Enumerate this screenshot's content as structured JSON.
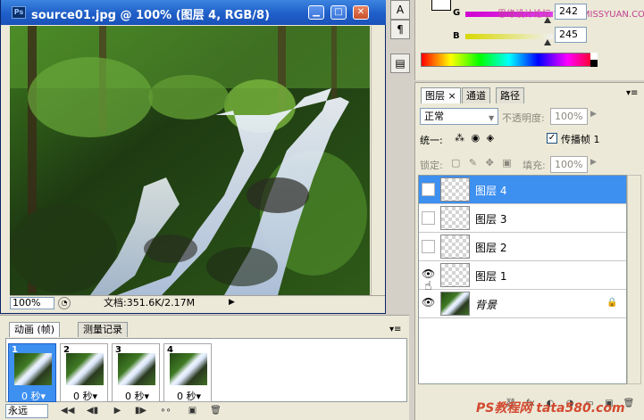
{
  "document": {
    "title": "source01.jpg @ 100% (图层 4, RGB/8)",
    "app_icon": "Ps",
    "window_buttons": {
      "minimize": "▁",
      "maximize": "□",
      "close": "✕"
    },
    "zoom": "100%",
    "doc_info": "文档:351.6K/2.17M",
    "status_arrow": "▶"
  },
  "side_strip": {
    "icons": [
      "A",
      "¶",
      "▤"
    ]
  },
  "color_panel": {
    "g_label": "G",
    "b_label": "B",
    "g_value": "242",
    "b_value": "245",
    "watermark": "思缘设计论坛 WWW.MISSYUAN.COM",
    "colors": {
      "g_track": "#e040f0",
      "b_track": "#e8e800"
    }
  },
  "animation_panel": {
    "tabs": [
      {
        "label": "动画 (帧)"
      },
      {
        "label": "测量记录"
      }
    ],
    "menu_icon": "▾≡",
    "frames": [
      {
        "number": "1",
        "delay": "0 秒▾",
        "selected": true
      },
      {
        "number": "2",
        "delay": "0 秒▾",
        "selected": false
      },
      {
        "number": "3",
        "delay": "0 秒▾",
        "selected": false
      },
      {
        "number": "4",
        "delay": "0 秒▾",
        "selected": false
      }
    ],
    "loop": "永远",
    "toolbar_icons": [
      "◀◀",
      "◀▮",
      "▶",
      "▮▶",
      "∘∘",
      "▣",
      "🗑"
    ]
  },
  "layers_panel": {
    "tabs": [
      {
        "label": "图层 ×"
      },
      {
        "label": "通道"
      },
      {
        "label": "路径"
      }
    ],
    "menu_icon": "▾≡",
    "blend_mode": "正常",
    "opacity_label": "不透明度:",
    "opacity": "100%",
    "unify_label": "统一:",
    "unify_icons": "⁂ ◉ ◈",
    "propagate_label": "传播帧 1",
    "propagate_checked": "✓",
    "lock_label": "锁定:",
    "lock_icons": "▢ ✎ ✥ ▣",
    "fill_label": "填充:",
    "fill": "100%",
    "layers": [
      {
        "name": "图层 4",
        "visible": false,
        "selected": true
      },
      {
        "name": "图层 3",
        "visible": false,
        "selected": false
      },
      {
        "name": "图层 2",
        "visible": false,
        "selected": false
      },
      {
        "name": "图层 1",
        "visible": true,
        "selected": false
      },
      {
        "name": "背景",
        "visible": true,
        "selected": false
      }
    ],
    "eye_icon": "👁",
    "lock_icon": "🔒",
    "cursor_icon": "☝",
    "footer_icons": [
      "⛓",
      "fx",
      "◐",
      "◑",
      "▭",
      "▣",
      "🗑"
    ],
    "site_watermark": "PS教程网 tata580.com"
  }
}
